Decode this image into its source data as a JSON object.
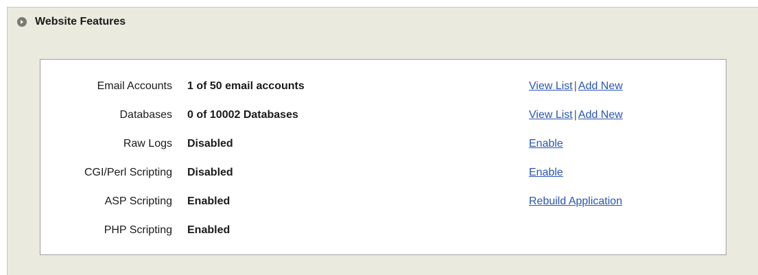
{
  "section": {
    "title": "Website Features"
  },
  "features": [
    {
      "label": "Email Accounts",
      "value": "1 of 50 email accounts",
      "actions": [
        "View List",
        "Add New"
      ]
    },
    {
      "label": "Databases",
      "value": "0 of 10002 Databases",
      "actions": [
        "View List",
        "Add New"
      ]
    },
    {
      "label": "Raw Logs",
      "value": "Disabled",
      "actions": [
        "Enable"
      ]
    },
    {
      "label": "CGI/Perl Scripting",
      "value": "Disabled",
      "actions": [
        "Enable"
      ]
    },
    {
      "label": "ASP Scripting",
      "value": "Enabled",
      "actions": [
        "Rebuild Application"
      ]
    },
    {
      "label": "PHP Scripting",
      "value": "Enabled",
      "actions": []
    }
  ],
  "colors": {
    "panel_bg": "#ebeadf",
    "link": "#2a55b0",
    "box_border": "#9f9f9f"
  }
}
